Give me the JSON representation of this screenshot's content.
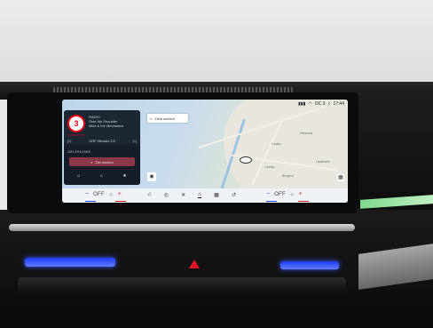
{
  "status_bar": {
    "signal": "▮▮▮",
    "wifi": "◠",
    "outside_temp": "OC 3",
    "bt": "ᛒ",
    "time": "17:44"
  },
  "map": {
    "search_placeholder": "Ziele suchen",
    "places": [
      "Lindau",
      "Bregenz",
      "Lochau",
      "Hörbranz",
      "Lauterach"
    ]
  },
  "media": {
    "logo_text": "3",
    "logo_subtext": "HITRADIO Ö3",
    "source": "RADIO",
    "line1": "Over My Shoulder",
    "line2": "Mike & the Mechanics",
    "prev": "|◁",
    "station": "ORF Hitradio Ö3",
    "next": "▷|"
  },
  "navigation": {
    "title": "ZIELEINGABE",
    "goal_button": "Ziel suchen",
    "shortcuts": [
      "⌂",
      "⌂",
      "★"
    ]
  },
  "climate": {
    "left": {
      "minus": "−",
      "state": "OFF",
      "plus": "+"
    },
    "right": {
      "minus": "−",
      "state": "OFF",
      "plus": "+"
    }
  },
  "menu": {
    "items": [
      "♫",
      "◎",
      "✕",
      "⌂",
      "▦",
      "↺"
    ],
    "active_index": 3
  },
  "colors": {
    "climate_cold": "#1a4ad6",
    "climate_warm": "#d22222",
    "goal_button": "#8a3847"
  }
}
